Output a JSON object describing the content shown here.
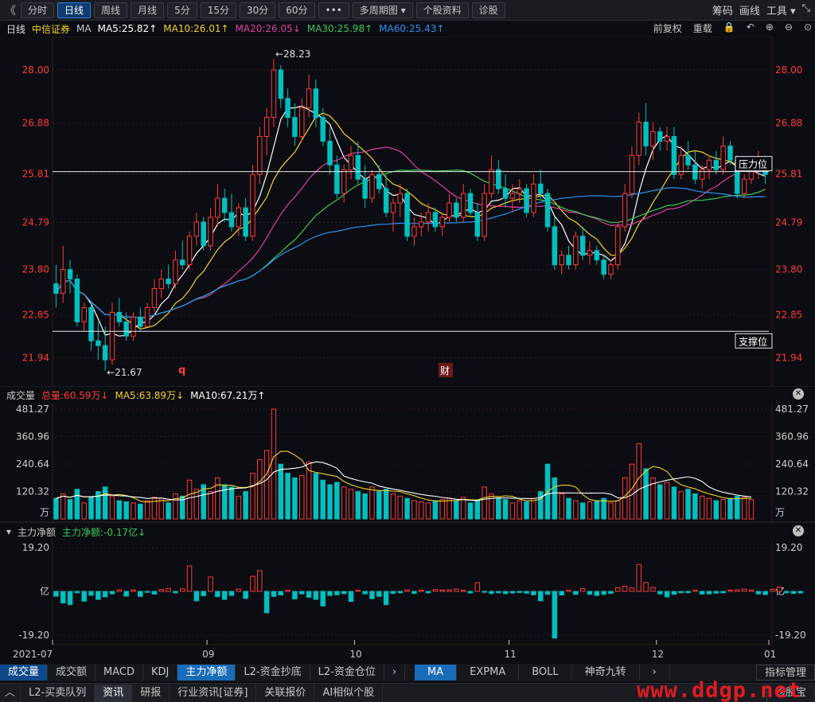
{
  "toolbar": {
    "back": "《",
    "periods": [
      "分时",
      "日线",
      "周线",
      "月线",
      "5分",
      "15分",
      "30分",
      "60分",
      "•••",
      "多周期图 ▾",
      "个股资料",
      "诊股"
    ],
    "active_index": 1,
    "right": [
      "筹码",
      "画线",
      "工具 ▾",
      "⤡"
    ]
  },
  "ma_header": {
    "period": "日线",
    "stock": "中信证券",
    "ma": "MA",
    "ma5": "MA5:25.82↑",
    "ma10": "MA10:26.01↑",
    "ma20": "MA20:26.05↓",
    "ma30": "MA30:25.98↑",
    "ma60": "MA60:25.43↑",
    "right": [
      "前复权",
      "重载",
      "🔒",
      "↶",
      "⊕",
      "⊖",
      "⊙"
    ]
  },
  "colors": {
    "up": "#ff3b3b",
    "down": "#00c0c0",
    "ma5": "#ffffff",
    "ma10": "#f3d22a",
    "ma20": "#e040a0",
    "ma30": "#3cc85a",
    "ma60": "#2f8ff0",
    "grid": "#3a1a1a"
  },
  "price_axis": {
    "ticks": [
      "28.00",
      "26.88",
      "25.81",
      "24.79",
      "23.80",
      "22.85",
      "21.94"
    ],
    "tick_values": [
      28.0,
      26.88,
      25.81,
      24.79,
      23.8,
      22.85,
      21.94
    ],
    "high_label": "←28.23",
    "low_label": "←21.67",
    "resistance_label": "压力位",
    "support_label": "支撑位",
    "resistance": 25.86,
    "support": 22.5,
    "marker_q": "q",
    "marker_cai": "财"
  },
  "volume_header": {
    "name": "成交量",
    "total": "总量:60.59万↓",
    "ma5": "MA5:63.89万↓",
    "ma10": "MA10:67.21万↑"
  },
  "volume_axis": {
    "ticks": [
      "481.27",
      "360.96",
      "240.64",
      "120.32",
      "万"
    ]
  },
  "flow_header": {
    "icon": "▾",
    "name": "主力净额",
    "value": "主力净额:-0.17亿↓"
  },
  "flow_axis": {
    "ticks": [
      "19.20",
      "亿",
      "-19.20"
    ]
  },
  "x_axis": {
    "labels": [
      "2021-07",
      "09",
      "10",
      "11",
      "12",
      "01"
    ]
  },
  "indicator_tabs": {
    "left": [
      "成交量",
      "成交额",
      "MACD",
      "KDJ",
      "主力净额",
      "L2-资金抄底",
      "L2-资金仓位",
      "›"
    ],
    "left_active": 0,
    "left_active2": 4,
    "right": [
      "MA",
      "EXPMA",
      "BOLL",
      "神奇九转",
      "›"
    ],
    "right_active": 0,
    "manage": "指标管理"
  },
  "bottom_bar": {
    "items": [
      "L2-买卖队列",
      "资讯",
      "研报",
      "行业资讯[证券]",
      "关联报价",
      "AI相似个股"
    ],
    "active": 1,
    "right_button": "诊股宝"
  },
  "watermark": "www.ddgp.net",
  "chart_data": {
    "type": "candlestick",
    "y_range": [
      21.5,
      28.6
    ],
    "ohlc": [
      [
        23.5,
        23.9,
        23.0,
        23.3
      ],
      [
        23.3,
        24.3,
        23.1,
        23.8
      ],
      [
        23.8,
        24.0,
        23.3,
        23.6
      ],
      [
        23.6,
        23.7,
        22.6,
        22.7
      ],
      [
        22.7,
        23.1,
        22.5,
        23.0
      ],
      [
        23.0,
        23.1,
        22.1,
        22.3
      ],
      [
        22.3,
        22.7,
        21.9,
        22.2
      ],
      [
        22.2,
        22.6,
        21.67,
        21.9
      ],
      [
        21.9,
        23.1,
        21.8,
        22.9
      ],
      [
        22.9,
        23.2,
        22.6,
        22.7
      ],
      [
        22.7,
        22.9,
        22.3,
        22.4
      ],
      [
        22.4,
        22.9,
        22.3,
        22.8
      ],
      [
        22.8,
        23.0,
        22.5,
        22.6
      ],
      [
        22.6,
        23.1,
        22.6,
        23.0
      ],
      [
        23.0,
        23.6,
        22.9,
        23.4
      ],
      [
        23.4,
        23.8,
        23.2,
        23.6
      ],
      [
        23.6,
        23.9,
        23.4,
        23.5
      ],
      [
        23.5,
        24.2,
        23.4,
        24.0
      ],
      [
        24.0,
        24.4,
        23.8,
        23.9
      ],
      [
        23.9,
        24.6,
        23.8,
        24.5
      ],
      [
        24.5,
        25.0,
        24.3,
        24.8
      ],
      [
        24.8,
        24.9,
        24.2,
        24.3
      ],
      [
        24.3,
        25.1,
        24.2,
        24.9
      ],
      [
        24.9,
        25.6,
        24.7,
        25.3
      ],
      [
        25.3,
        25.5,
        24.8,
        25.0
      ],
      [
        25.0,
        25.4,
        24.6,
        24.7
      ],
      [
        24.7,
        25.2,
        24.5,
        25.1
      ],
      [
        25.1,
        25.3,
        24.4,
        24.5
      ],
      [
        24.5,
        26.0,
        24.4,
        25.8
      ],
      [
        25.8,
        26.8,
        25.6,
        26.6
      ],
      [
        26.6,
        27.2,
        26.2,
        27.0
      ],
      [
        27.0,
        28.23,
        26.8,
        28.0
      ],
      [
        28.0,
        28.1,
        27.2,
        27.4
      ],
      [
        27.4,
        27.6,
        26.8,
        27.0
      ],
      [
        27.0,
        27.3,
        26.4,
        26.6
      ],
      [
        26.6,
        27.4,
        26.5,
        27.2
      ],
      [
        27.2,
        27.9,
        27.0,
        27.6
      ],
      [
        27.6,
        27.8,
        26.8,
        27.0
      ],
      [
        27.0,
        27.2,
        26.4,
        26.5
      ],
      [
        26.5,
        26.8,
        25.8,
        26.0
      ],
      [
        26.0,
        26.2,
        25.3,
        25.4
      ],
      [
        25.4,
        26.0,
        25.2,
        25.9
      ],
      [
        25.9,
        26.4,
        25.7,
        26.2
      ],
      [
        26.2,
        26.5,
        25.6,
        25.7
      ],
      [
        25.7,
        26.0,
        25.1,
        25.3
      ],
      [
        25.3,
        25.9,
        25.2,
        25.8
      ],
      [
        25.8,
        26.0,
        25.4,
        25.5
      ],
      [
        25.5,
        25.8,
        24.9,
        25.0
      ],
      [
        25.0,
        25.3,
        24.6,
        25.2
      ],
      [
        25.2,
        25.6,
        24.9,
        25.4
      ],
      [
        25.4,
        25.5,
        24.4,
        24.5
      ],
      [
        24.5,
        24.9,
        24.3,
        24.7
      ],
      [
        24.7,
        25.0,
        24.5,
        24.8
      ],
      [
        24.8,
        25.2,
        24.6,
        25.0
      ],
      [
        25.0,
        25.1,
        24.6,
        24.7
      ],
      [
        24.7,
        25.0,
        24.5,
        24.9
      ],
      [
        24.9,
        25.4,
        24.8,
        25.2
      ],
      [
        25.2,
        25.3,
        24.8,
        24.9
      ],
      [
        24.9,
        25.6,
        24.8,
        25.4
      ],
      [
        25.4,
        25.5,
        24.9,
        25.0
      ],
      [
        25.0,
        25.2,
        24.4,
        24.5
      ],
      [
        24.5,
        25.6,
        24.4,
        25.4
      ],
      [
        25.4,
        26.2,
        25.3,
        25.9
      ],
      [
        25.9,
        26.1,
        25.4,
        25.5
      ],
      [
        25.5,
        25.8,
        25.1,
        25.3
      ],
      [
        25.3,
        25.6,
        25.0,
        25.4
      ],
      [
        25.4,
        25.7,
        25.2,
        25.5
      ],
      [
        25.5,
        25.6,
        24.9,
        25.0
      ],
      [
        25.0,
        25.8,
        24.9,
        25.6
      ],
      [
        25.6,
        25.9,
        25.3,
        25.4
      ],
      [
        25.4,
        25.5,
        24.6,
        24.7
      ],
      [
        24.7,
        24.9,
        23.8,
        23.9
      ],
      [
        23.9,
        24.2,
        23.7,
        24.1
      ],
      [
        24.1,
        24.3,
        23.8,
        23.9
      ],
      [
        23.9,
        24.6,
        23.8,
        24.5
      ],
      [
        24.5,
        24.7,
        24.0,
        24.1
      ],
      [
        24.1,
        24.4,
        23.9,
        24.2
      ],
      [
        24.2,
        24.3,
        23.9,
        24.0
      ],
      [
        24.0,
        24.1,
        23.6,
        23.7
      ],
      [
        23.7,
        24.0,
        23.6,
        23.9
      ],
      [
        23.9,
        24.8,
        23.8,
        24.7
      ],
      [
        24.7,
        25.6,
        24.6,
        25.4
      ],
      [
        25.4,
        26.4,
        25.3,
        26.2
      ],
      [
        26.2,
        27.1,
        26.0,
        26.9
      ],
      [
        26.9,
        27.3,
        26.2,
        26.4
      ],
      [
        26.4,
        26.9,
        26.1,
        26.7
      ],
      [
        26.7,
        26.8,
        26.3,
        26.5
      ],
      [
        26.5,
        26.8,
        26.3,
        26.6
      ],
      [
        26.6,
        26.8,
        25.7,
        25.8
      ],
      [
        25.8,
        26.4,
        25.7,
        26.2
      ],
      [
        26.2,
        26.5,
        25.9,
        26.0
      ],
      [
        26.0,
        26.3,
        25.6,
        25.7
      ],
      [
        25.7,
        26.0,
        25.5,
        25.9
      ],
      [
        25.9,
        26.2,
        25.7,
        26.1
      ],
      [
        26.1,
        26.3,
        25.8,
        25.9
      ],
      [
        25.9,
        26.6,
        25.8,
        26.4
      ],
      [
        26.4,
        26.5,
        26.0,
        26.1
      ],
      [
        26.1,
        26.2,
        25.3,
        25.4
      ],
      [
        25.4,
        25.8,
        25.3,
        25.7
      ],
      [
        25.7,
        26.1,
        25.6,
        25.9
      ],
      [
        25.9,
        26.3,
        25.7,
        26.0
      ],
      [
        26.0,
        26.2,
        25.6,
        25.8
      ]
    ],
    "volume_range": [
      0,
      481.27
    ],
    "volume": [
      90,
      110,
      85,
      130,
      70,
      95,
      120,
      140,
      100,
      80,
      75,
      70,
      65,
      80,
      95,
      90,
      70,
      110,
      100,
      170,
      130,
      150,
      120,
      180,
      150,
      140,
      100,
      120,
      200,
      260,
      300,
      481,
      240,
      200,
      180,
      190,
      250,
      200,
      170,
      150,
      160,
      140,
      130,
      120,
      110,
      140,
      120,
      130,
      110,
      100,
      90,
      80,
      75,
      70,
      80,
      85,
      90,
      80,
      95,
      70,
      80,
      140,
      110,
      90,
      85,
      70,
      80,
      75,
      90,
      120,
      240,
      180,
      110,
      90,
      80,
      70,
      75,
      80,
      90,
      70,
      80,
      180,
      240,
      330,
      220,
      180,
      150,
      160,
      140,
      120,
      130,
      110,
      100,
      90,
      80,
      85,
      90,
      100,
      95,
      85
    ],
    "flow_range": [
      -19.2,
      19.2
    ],
    "flow": [
      -2.1,
      -5.1,
      -5.8,
      -0.6,
      -4.3,
      -1.7,
      -3.5,
      -2.4,
      -1.1,
      0.7,
      -2.1,
      0.6,
      -2.2,
      -0.4,
      -1.2,
      0.8,
      1.3,
      -0.6,
      1.1,
      11.2,
      -4.1,
      -1.9,
      6.3,
      -2.3,
      -3.5,
      -1.8,
      1.0,
      -3.1,
      6.6,
      9.1,
      -9.4,
      -2.2,
      -1.6,
      0.5,
      -3.3,
      -1.1,
      -2.6,
      -3.5,
      -6.4,
      -1.8,
      -1.5,
      -1.0,
      -4.4,
      0.5,
      -1.1,
      -3.2,
      -2.2,
      -5.8,
      -0.9,
      -0.6,
      0.6,
      -0.9,
      0.5,
      -0.6,
      0.8,
      0.6,
      0.7,
      1.0,
      0.5,
      -0.7,
      3.8,
      -0.4,
      -0.9,
      -0.6,
      -1.0,
      -0.7,
      -0.5,
      -0.8,
      -1.5,
      -4.1,
      -1.3,
      -20.5,
      -1.6,
      0.5,
      -1.3,
      1.2,
      -1.3,
      -1.8,
      -1.3,
      -0.9,
      1.6,
      2.3,
      1.5,
      11.8,
      3.9,
      1.7,
      -1.1,
      -2.4,
      -1.3,
      -0.6,
      -0.6,
      0.5,
      -1.2,
      -1.1,
      -0.8,
      -0.6,
      0.6,
      0.7,
      1.0,
      0.6,
      -1.1,
      -1.4,
      0.9,
      1.8,
      -0.6,
      -0.9,
      -0.7
    ]
  }
}
